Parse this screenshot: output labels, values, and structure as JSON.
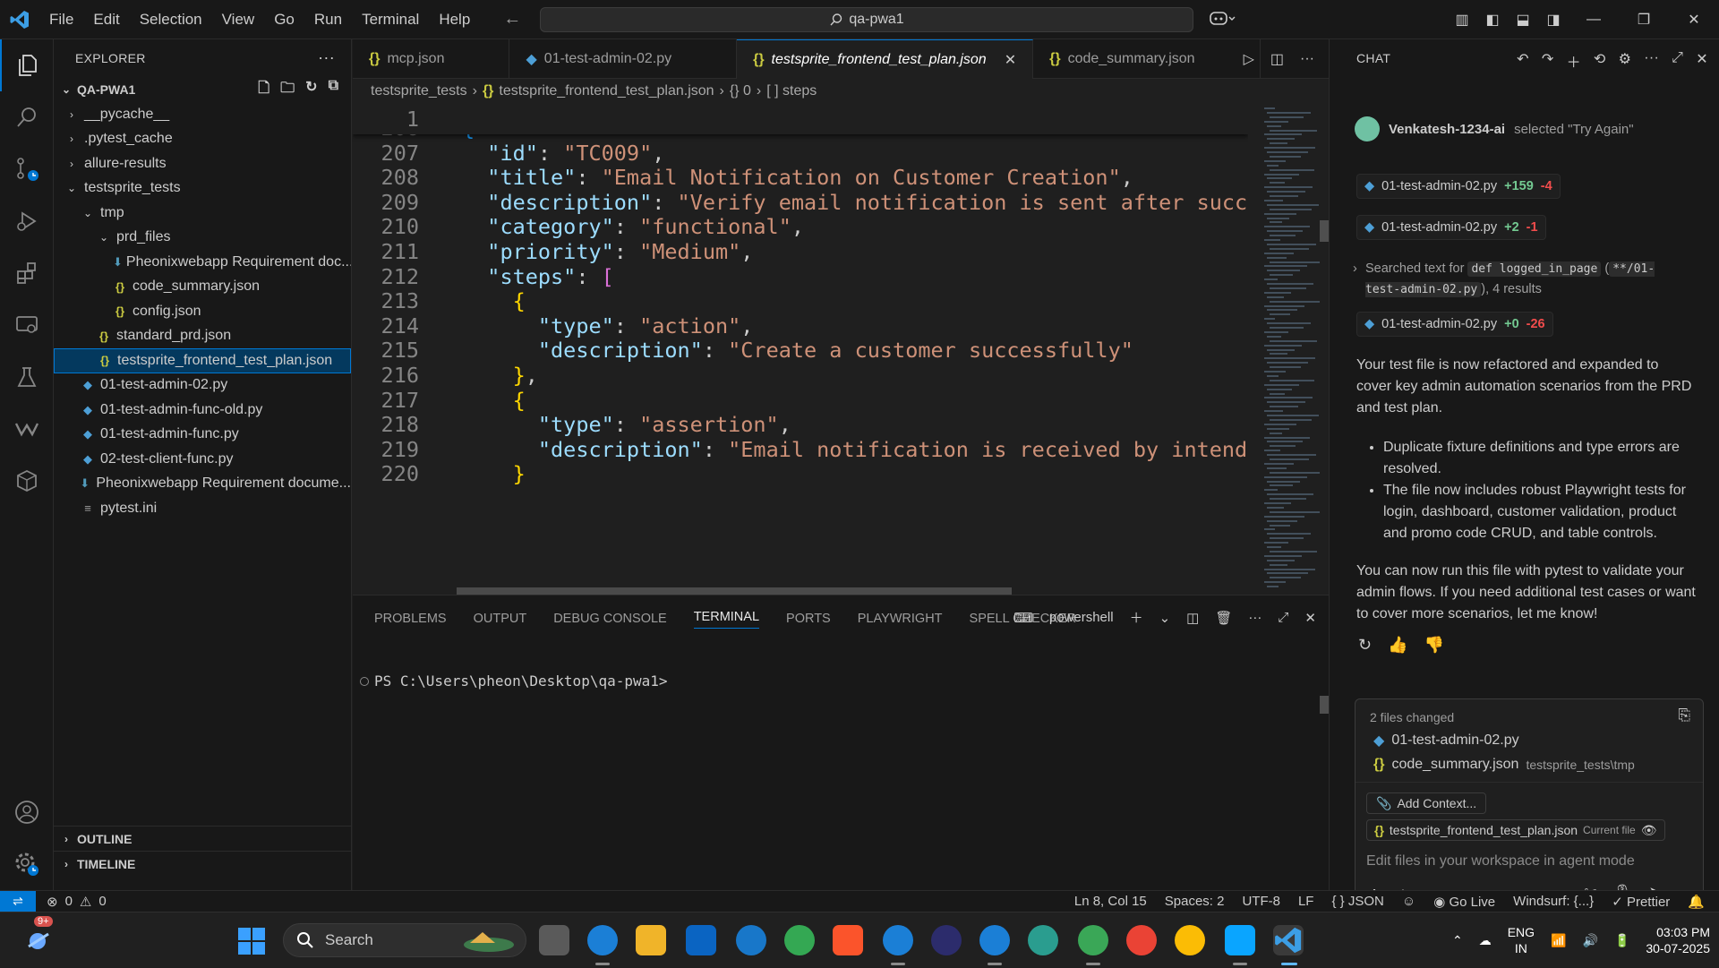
{
  "menu": [
    "File",
    "Edit",
    "Selection",
    "View",
    "Go",
    "Run",
    "Terminal",
    "Help"
  ],
  "command_center": "qa-pwa1",
  "explorer": {
    "header": "EXPLORER",
    "root": "QA-PWA1",
    "items": [
      {
        "indent": 0,
        "chev": "›",
        "icon": "",
        "label": "__pycache__"
      },
      {
        "indent": 0,
        "chev": "›",
        "icon": "",
        "label": ".pytest_cache"
      },
      {
        "indent": 0,
        "chev": "›",
        "icon": "",
        "label": "allure-results"
      },
      {
        "indent": 0,
        "chev": "⌄",
        "icon": "",
        "label": "testsprite_tests"
      },
      {
        "indent": 1,
        "chev": "⌄",
        "icon": "",
        "label": "tmp"
      },
      {
        "indent": 2,
        "chev": "⌄",
        "icon": "",
        "label": "prd_files"
      },
      {
        "indent": 3,
        "chev": "",
        "icon": "md",
        "label": "Pheonixwebapp Requirement doc..."
      },
      {
        "indent": 2,
        "chev": "",
        "icon": "json",
        "label": "code_summary.json"
      },
      {
        "indent": 2,
        "chev": "",
        "icon": "json",
        "label": "config.json"
      },
      {
        "indent": 1,
        "chev": "",
        "icon": "json",
        "label": "standard_prd.json"
      },
      {
        "indent": 1,
        "chev": "",
        "icon": "json",
        "label": "testsprite_frontend_test_plan.json",
        "selected": true
      },
      {
        "indent": 0,
        "chev": "",
        "icon": "py",
        "label": "01-test-admin-02.py"
      },
      {
        "indent": 0,
        "chev": "",
        "icon": "py",
        "label": "01-test-admin-func-old.py"
      },
      {
        "indent": 0,
        "chev": "",
        "icon": "py",
        "label": "01-test-admin-func.py"
      },
      {
        "indent": 0,
        "chev": "",
        "icon": "py",
        "label": "02-test-client-func.py"
      },
      {
        "indent": 0,
        "chev": "",
        "icon": "md",
        "label": "Pheonixwebapp Requirement docume..."
      },
      {
        "indent": 0,
        "chev": "",
        "icon": "ini",
        "label": "pytest.ini"
      }
    ],
    "outline": "OUTLINE",
    "timeline": "TIMELINE"
  },
  "tabs": [
    {
      "label": "mcp.json",
      "icon": "json"
    },
    {
      "label": "01-test-admin-02.py",
      "icon": "py"
    },
    {
      "label": "testsprite_frontend_test_plan.json",
      "icon": "json",
      "active": true
    },
    {
      "label": "code_summary.json",
      "icon": "json"
    }
  ],
  "breadcrumb": {
    "folder": "testsprite_tests",
    "file": "testsprite_frontend_test_plan.json",
    "obj": "{} 0",
    "arr": "[ ] steps"
  },
  "sticky_line": {
    "num": "1",
    "text": ""
  },
  "code_lines": [
    {
      "num": "206",
      "html": "<span class='b2'>{</span>"
    },
    {
      "num": "207",
      "html": "  <span class='k'>\"id\"</span><span class='p'>: </span><span class='s'>\"TC009\"</span><span class='p'>,</span>"
    },
    {
      "num": "208",
      "html": "  <span class='k'>\"title\"</span><span class='p'>: </span><span class='s'>\"Email Notification on Customer Creation\"</span><span class='p'>,</span>"
    },
    {
      "num": "209",
      "html": "  <span class='k'>\"description\"</span><span class='p'>: </span><span class='s'>\"Verify email notification is sent after succes</span>"
    },
    {
      "num": "210",
      "html": "  <span class='k'>\"category\"</span><span class='p'>: </span><span class='s'>\"functional\"</span><span class='p'>,</span>"
    },
    {
      "num": "211",
      "html": "  <span class='k'>\"priority\"</span><span class='p'>: </span><span class='s'>\"Medium\"</span><span class='p'>,</span>"
    },
    {
      "num": "212",
      "html": "  <span class='k'>\"steps\"</span><span class='p'>: </span><span class='b1'>[</span>"
    },
    {
      "num": "213",
      "html": "    <span class='b3'>{</span>"
    },
    {
      "num": "214",
      "html": "      <span class='k'>\"type\"</span><span class='p'>: </span><span class='s'>\"action\"</span><span class='p'>,</span>"
    },
    {
      "num": "215",
      "html": "      <span class='k'>\"description\"</span><span class='p'>: </span><span class='s'>\"Create a customer successfully\"</span>"
    },
    {
      "num": "216",
      "html": "    <span class='b3'>}</span><span class='p'>,</span>"
    },
    {
      "num": "217",
      "html": "    <span class='b3'>{</span>"
    },
    {
      "num": "218",
      "html": "      <span class='k'>\"type\"</span><span class='p'>: </span><span class='s'>\"assertion\"</span><span class='p'>,</span>"
    },
    {
      "num": "219",
      "html": "      <span class='k'>\"description\"</span><span class='p'>: </span><span class='s'>\"Email notification is received by intended</span>"
    },
    {
      "num": "220",
      "html": "    <span class='b3'>}</span>"
    }
  ],
  "panel": {
    "tabs": [
      "PROBLEMS",
      "OUTPUT",
      "DEBUG CONSOLE",
      "TERMINAL",
      "PORTS",
      "PLAYWRIGHT",
      "SPELL CHECKER"
    ],
    "active_tab": "TERMINAL",
    "shell": "powershell",
    "prompt": "PS C:\\Users\\pheon\\Desktop\\qa-pwa1>"
  },
  "chat": {
    "header": "CHAT",
    "user": "Venkatesh-1234-ai",
    "user_action": "selected \"Try Again\"",
    "edits": [
      {
        "file": "01-test-admin-02.py",
        "add": "+159",
        "del": "-4"
      },
      {
        "file": "01-test-admin-02.py",
        "add": "+2",
        "del": "-1"
      },
      {
        "file": "01-test-admin-02.py",
        "add": "+0",
        "del": "-26"
      }
    ],
    "searched_pre": "Searched text for",
    "searched_code1": "def logged_in_page",
    "searched_paren_open": "(",
    "searched_code2": "**/01-test-admin-02.py",
    "searched_post": "), 4 results",
    "message_intro": "Your test file is now refactored and expanded to cover key admin automation scenarios from the PRD and test plan.",
    "bullets": [
      "Duplicate fixture definitions and type errors are resolved.",
      "The file now includes robust Playwright tests for login, dashboard, customer validation, product and promo code CRUD, and table controls."
    ],
    "message_outro": "You can now run this file with pytest to validate your admin flows. If you need additional test cases or want to cover more scenarios, let me know!",
    "files_changed": "2 files changed",
    "changed_files": [
      {
        "name": "01-test-admin-02.py",
        "icon": "py",
        "sub": ""
      },
      {
        "name": "code_summary.json",
        "icon": "json",
        "sub": "testsprite_tests\\tmp"
      }
    ],
    "add_context": "Add Context...",
    "current_file": "testsprite_frontend_test_plan.json",
    "current_file_tag": "Current file",
    "placeholder": "Edit files in your workspace in agent mode",
    "mode": "Agent"
  },
  "status": {
    "errors": "0",
    "warnings": "0",
    "position": "Ln 8, Col 15",
    "spaces": "Spaces: 2",
    "encoding": "UTF-8",
    "eol": "LF",
    "language": "JSON",
    "golive": "Go Live",
    "windsurf": "Windsurf: {...}",
    "prettier": "Prettier"
  },
  "taskbar": {
    "badge": "9+",
    "search": "Search",
    "lang1": "ENG",
    "lang2": "IN",
    "time": "03:03 PM",
    "date": "30-07-2025"
  }
}
